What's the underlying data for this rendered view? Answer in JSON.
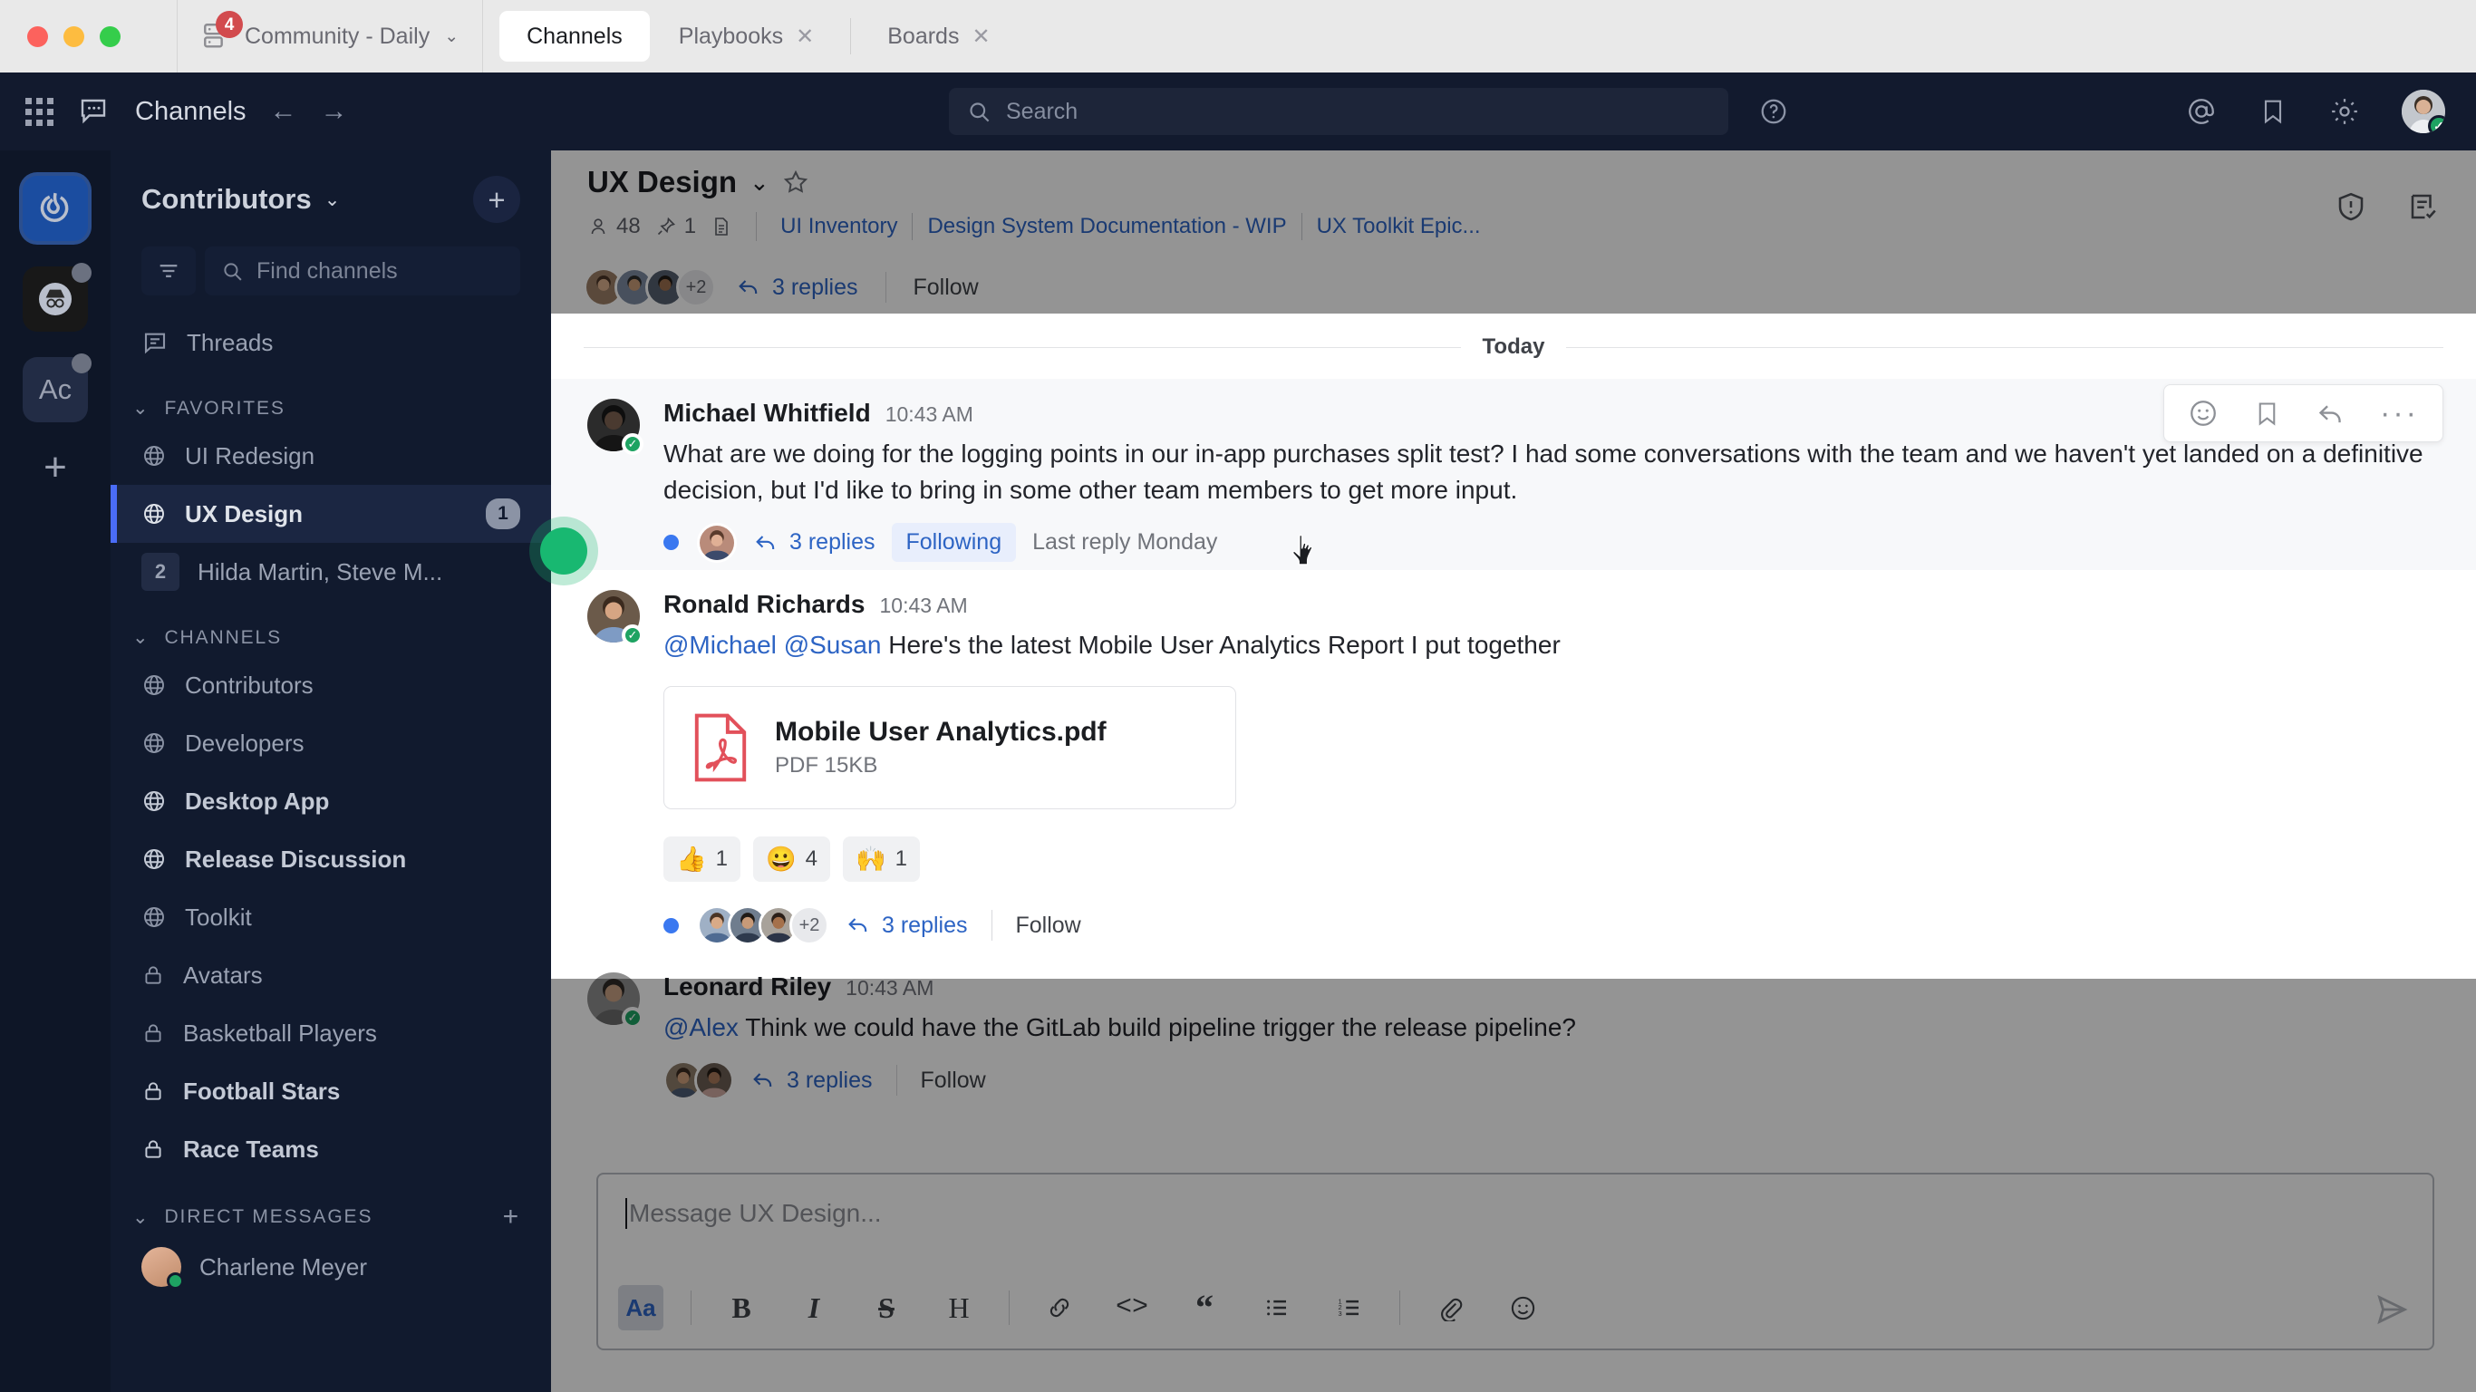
{
  "window": {
    "team_switcher": {
      "name": "Community - Daily",
      "badge": "4",
      "icon": "server-icon",
      "chevron": "⌄"
    },
    "tabs": [
      {
        "label": "Channels",
        "active": true,
        "closable": false
      },
      {
        "label": "Playbooks",
        "active": false,
        "closable": true,
        "close": "✕"
      },
      {
        "label": "Boards",
        "active": false,
        "closable": true,
        "close": "✕"
      }
    ]
  },
  "global_header": {
    "product_title": "Channels",
    "back_arrow": "←",
    "forward_arrow": "→",
    "search_placeholder": "Search",
    "icons": [
      "grid-icon",
      "chat-icon",
      "help-icon",
      "mentions-icon",
      "saved-posts-icon",
      "settings-icon"
    ],
    "avatar_status": "online"
  },
  "rail": {
    "teams": [
      {
        "name": "Mattermost",
        "type": "logo",
        "selected": true,
        "dot": false
      },
      {
        "name": "Incognito",
        "type": "incognito",
        "selected": false,
        "dot": true
      },
      {
        "name": "Ac",
        "type": "text",
        "label": "Ac",
        "selected": false,
        "dot": true
      }
    ],
    "add_label": "+"
  },
  "sidebar": {
    "team_name": "Contributors",
    "add_channel_label": "+",
    "find_placeholder": "Find channels",
    "threads_label": "Threads",
    "sections": [
      {
        "title": "FAVORITES",
        "collapse": "⌄",
        "add": null,
        "items": [
          {
            "label": "UI Redesign",
            "icon": "globe-icon",
            "unread": false,
            "badge": null,
            "active": false
          },
          {
            "label": "UX Design",
            "icon": "globe-icon",
            "unread": true,
            "badge": "1",
            "active": true
          },
          {
            "label": "Hilda Martin, Steve M...",
            "icon": "group-count",
            "unread": false,
            "badge_left": "2",
            "active": false
          }
        ]
      },
      {
        "title": "CHANNELS",
        "collapse": "⌄",
        "add": null,
        "items": [
          {
            "label": "Contributors",
            "icon": "globe-icon",
            "unread": false,
            "badge": null,
            "active": false
          },
          {
            "label": "Developers",
            "icon": "globe-icon",
            "unread": false,
            "badge": null,
            "active": false
          },
          {
            "label": "Desktop App",
            "icon": "globe-icon",
            "unread": true,
            "badge": null,
            "active": false
          },
          {
            "label": "Release Discussion",
            "icon": "globe-icon",
            "unread": true,
            "badge": null,
            "active": false
          },
          {
            "label": "Toolkit",
            "icon": "globe-icon",
            "unread": false,
            "badge": null,
            "active": false
          },
          {
            "label": "Avatars",
            "icon": "lock-icon",
            "unread": false,
            "badge": null,
            "active": false
          },
          {
            "label": "Basketball Players",
            "icon": "lock-icon",
            "unread": false,
            "badge": null,
            "active": false
          },
          {
            "label": "Football Stars",
            "icon": "lock-icon",
            "unread": true,
            "badge": null,
            "active": false
          },
          {
            "label": "Race Teams",
            "icon": "lock-icon",
            "unread": true,
            "badge": null,
            "active": false
          }
        ]
      },
      {
        "title": "DIRECT MESSAGES",
        "collapse": "⌄",
        "add": "+",
        "items": [
          {
            "label": "Charlene Meyer",
            "icon": "avatar",
            "unread": false,
            "badge": null,
            "active": false
          }
        ]
      }
    ]
  },
  "channel": {
    "name": "UX Design",
    "chevron": "⌄",
    "favorite_icon": "star-icon",
    "member_count": "48",
    "pinned_count": "1",
    "files_icon": "file-icon",
    "header_links": [
      "UI Inventory",
      "Design System Documentation - WIP",
      "UX Toolkit Epic..."
    ],
    "right_icons": [
      "channel-info-icon",
      "playbooks-checklist-icon"
    ]
  },
  "messages": {
    "partial_top": {
      "more": "+2",
      "replies": "3 replies",
      "follow": "Follow"
    },
    "day_separator": "Today",
    "items": [
      {
        "author": "Michael Whitfield",
        "time": "10:43 AM",
        "text": "What are we doing for the logging points in our in-app purchases split test? I had some conversations with the team and we haven't yet landed on a definitive decision, but I'd like to bring in some other team members to get more input.",
        "thread": {
          "replies": "3 replies",
          "state_label": "Following",
          "last_reply": "Last reply Monday",
          "unread": true
        },
        "hover_tools": [
          "emoji-icon",
          "save-icon",
          "reply-icon",
          "more-icon"
        ],
        "highlighted": true
      },
      {
        "author": "Ronald Richards",
        "time": "10:43 AM",
        "mentions": [
          "@Michael",
          "@Susan"
        ],
        "text": "Here's the latest Mobile User Analytics Report I put together",
        "attachment": {
          "filename": "Mobile User Analytics.pdf",
          "meta": "PDF 15KB",
          "type": "pdf"
        },
        "reactions": [
          {
            "emoji": "👍",
            "count": "1"
          },
          {
            "emoji": "😀",
            "count": "4"
          },
          {
            "emoji": "🙌",
            "count": "1"
          }
        ],
        "thread": {
          "more": "+2",
          "replies": "3 replies",
          "follow": "Follow",
          "unread": true
        },
        "highlighted": false
      },
      {
        "author": "Leonard Riley",
        "time": "10:43 AM",
        "mentions": [
          "@Alex"
        ],
        "text": "Think we could have the GitLab build pipeline trigger the release pipeline?",
        "thread": {
          "replies": "3 replies",
          "follow": "Follow",
          "unread": false
        },
        "highlighted": false
      }
    ]
  },
  "composer": {
    "placeholder": "Message UX Design...",
    "format_buttons": [
      {
        "name": "format-toggle",
        "label": "Aa",
        "active": true
      },
      {
        "name": "bold",
        "label": "B"
      },
      {
        "name": "italic",
        "label": "I"
      },
      {
        "name": "strikethrough",
        "label": "S"
      },
      {
        "name": "heading",
        "label": "H"
      },
      {
        "name": "link",
        "label": "🔗"
      },
      {
        "name": "code",
        "label": "<>"
      },
      {
        "name": "quote",
        "label": "❝"
      },
      {
        "name": "bullet-list",
        "label": "•"
      },
      {
        "name": "numbered-list",
        "label": "1."
      },
      {
        "name": "attachment",
        "label": "📎"
      },
      {
        "name": "emoji",
        "label": "☺"
      }
    ],
    "send_label": "➤"
  },
  "colors": {
    "accent_blue": "#2d64c4",
    "sidebar_bg": "#111a2e",
    "header_bg": "#121a2e",
    "online_green": "#1ea362",
    "pdf_red": "#e2505a",
    "badge_red": "#d24b4e"
  }
}
